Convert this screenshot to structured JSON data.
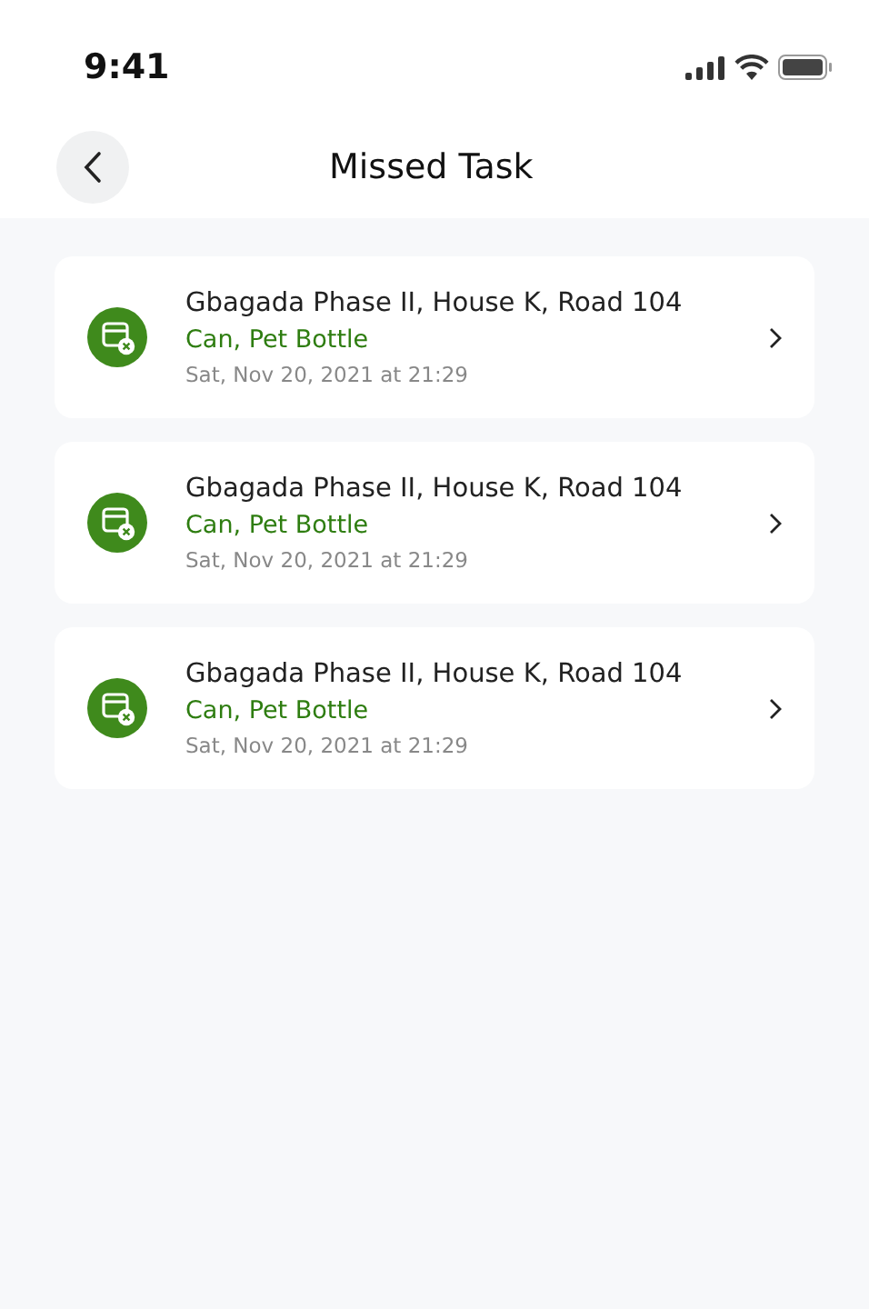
{
  "status_bar": {
    "time": "9:41"
  },
  "header": {
    "title": "Missed Task"
  },
  "tasks": [
    {
      "address": "Gbagada Phase II, House K, Road 104",
      "items": "Can, Pet Bottle",
      "date": "Sat, Nov 20, 2021 at 21:29"
    },
    {
      "address": "Gbagada Phase II, House K, Road 104",
      "items": "Can, Pet Bottle",
      "date": "Sat, Nov 20, 2021 at 21:29"
    },
    {
      "address": "Gbagada Phase II, House K, Road 104",
      "items": "Can, Pet Bottle",
      "date": "Sat, Nov 20, 2021 at 21:29"
    }
  ]
}
